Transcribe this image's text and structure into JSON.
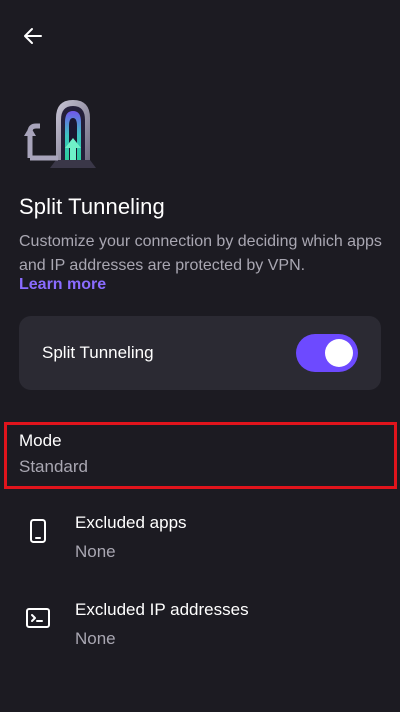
{
  "header": {
    "back_icon": "arrow-left-icon"
  },
  "hero": {
    "icon": "split-tunnel-illustration-icon"
  },
  "title": "Split Tunneling",
  "description": "Customize your connection by deciding which apps and IP addresses are protected by VPN.",
  "learn_more": "Learn more",
  "toggle": {
    "label": "Split Tunneling",
    "state": "on",
    "accent": "#6d4aff"
  },
  "mode": {
    "title": "Mode",
    "value": "Standard"
  },
  "excluded_apps": {
    "icon": "smartphone-icon",
    "title": "Excluded apps",
    "value": "None"
  },
  "excluded_ips": {
    "icon": "terminal-icon",
    "title": "Excluded IP addresses",
    "value": "None"
  },
  "colors": {
    "background": "#1c1b22",
    "card": "#2b2a33",
    "secondary_text": "#a9a7b2",
    "link": "#8a6cff",
    "highlight": "#e0141c"
  }
}
